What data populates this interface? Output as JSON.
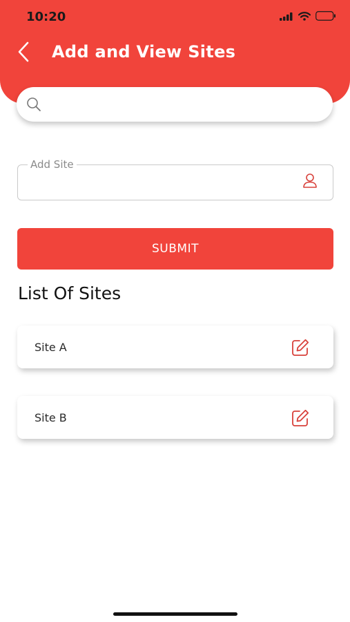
{
  "status_bar": {
    "time": "10:20",
    "icons": [
      "cellular-signal-icon",
      "wifi-icon",
      "battery-icon"
    ]
  },
  "header": {
    "title": "Add and View Sites",
    "back_icon": "chevron-left-icon",
    "background_color": "#f1443b"
  },
  "search": {
    "value": "",
    "placeholder": "",
    "icon": "search-icon"
  },
  "add_site": {
    "label": "Add Site",
    "value": "",
    "icon": "user-icon"
  },
  "submit": {
    "label": "SUBMIT"
  },
  "sites_section": {
    "title": "List Of Sites",
    "items": [
      {
        "name": "Site A",
        "action_icon": "edit-icon"
      },
      {
        "name": "Site B",
        "action_icon": "edit-icon"
      }
    ]
  },
  "colors": {
    "accent": "#f1443b",
    "icon_accent": "#d8403a"
  }
}
